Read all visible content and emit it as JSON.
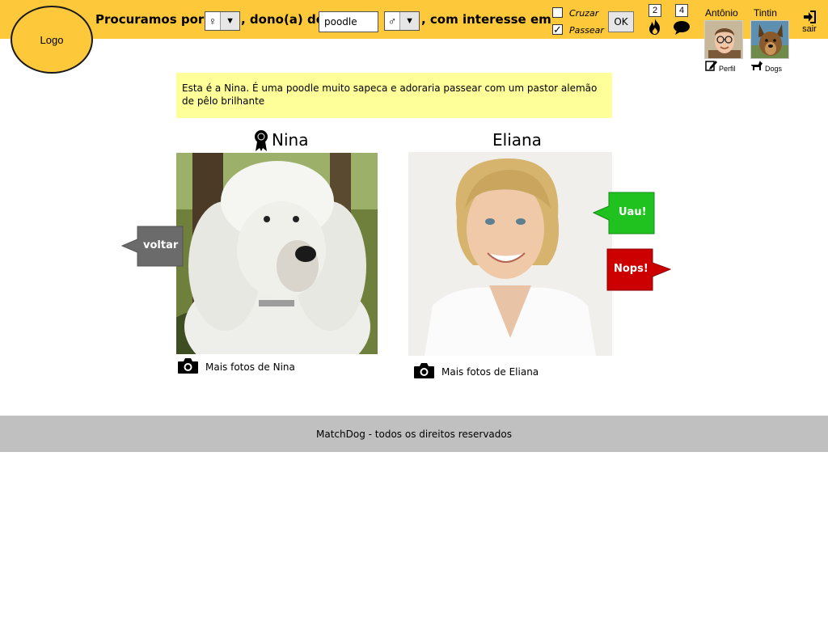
{
  "header": {
    "logo_text": "Logo",
    "search": {
      "prefix": "Procuramos por",
      "dog_sex": "♀",
      "owner_text": ", dono(a) de",
      "breed_value": "poodle",
      "owner_sex": "♂",
      "interest_text": ", com interesse em"
    },
    "interests": [
      {
        "label": "Cruzar",
        "checked": false,
        "mark": ""
      },
      {
        "label": "Passear",
        "checked": true,
        "mark": "✓"
      }
    ],
    "ok_label": "OK",
    "matches_count": "2",
    "messages_count": "4",
    "user": {
      "name": "Antônio",
      "link": "Perfil"
    },
    "dog": {
      "name": "Tintin",
      "link": "Dogs"
    },
    "logout_label": "sair"
  },
  "main": {
    "description": "Esta é a Nina. É uma poodle muito sapeca e adoraria passear com um pastor alemão de pêlo brilhante",
    "dog_profile": {
      "name": "Nina",
      "more_photos": "Mais fotos de Nina"
    },
    "owner_profile": {
      "name": "Eliana",
      "more_photos": "Mais fotos de Eliana"
    },
    "back_label": "voltar",
    "like_label": "Uau!",
    "dislike_label": "Nops!"
  },
  "footer": {
    "text": "MatchDog - todos os direitos reservados"
  },
  "colors": {
    "header_bg": "#fdc93a",
    "note_bg": "#ffff99",
    "like": "#1fc21f",
    "dislike": "#cc0000",
    "back": "#6b6b6b",
    "footer_bg": "#c0c0c0"
  }
}
